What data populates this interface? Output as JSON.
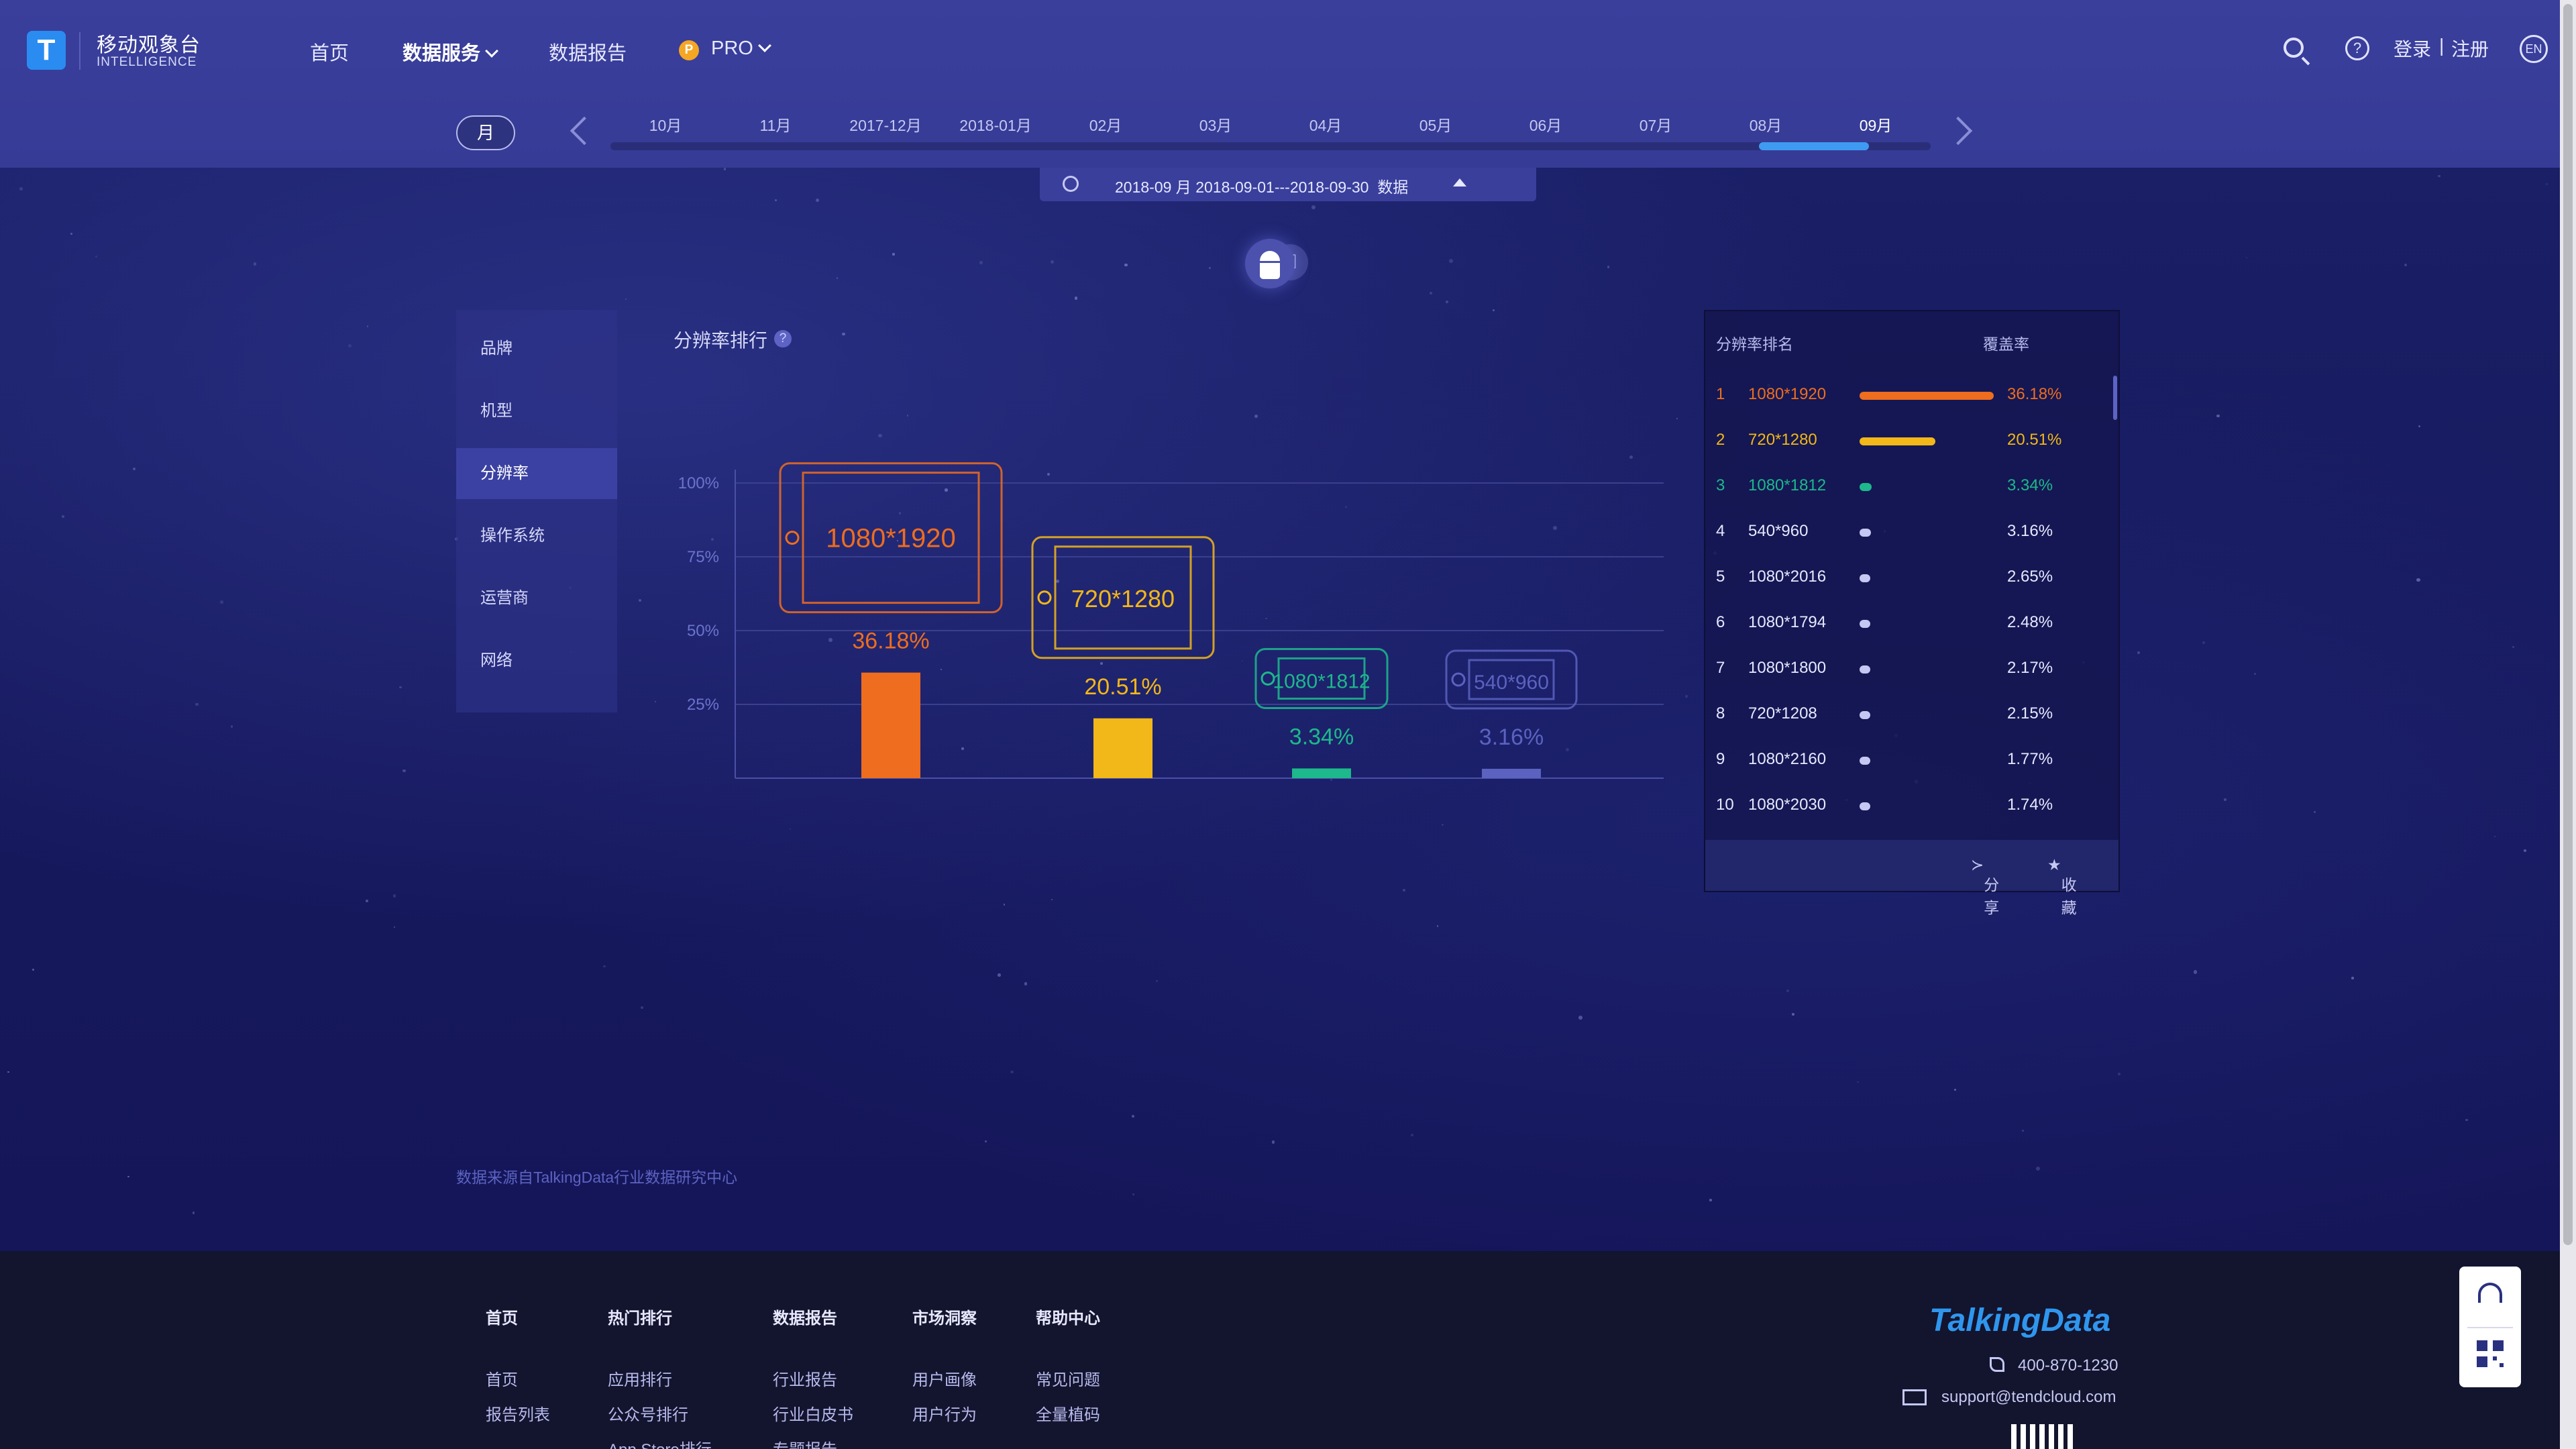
{
  "header": {
    "logo_letter": "T",
    "app_title": "移动观象台",
    "app_subtitle": "INTELLIGENCE",
    "nav": [
      {
        "label": "首页"
      },
      {
        "label": "数据服务"
      },
      {
        "label": "数据报告"
      },
      {
        "label": "PRO",
        "badge": "P"
      }
    ],
    "login": "登录",
    "divider": "|",
    "register": "注册",
    "lang": "EN",
    "help": "?"
  },
  "timeline": {
    "mode": "月",
    "months": [
      "10月",
      "11月",
      "2017-12月",
      "2018-01月",
      "02月",
      "03月",
      "04月",
      "05月",
      "06月",
      "07月",
      "08月",
      "09月"
    ],
    "selected": "09月",
    "date_range": "2018-09 月 2018-09-01---2018-09-30",
    "date_suffix": "数据"
  },
  "os_toggle": {
    "active": "android-icon",
    "inactive": "apple-icon"
  },
  "side_menu": {
    "items": [
      {
        "label": "品牌"
      },
      {
        "label": "机型"
      },
      {
        "label": "分辨率"
      },
      {
        "label": "操作系统"
      },
      {
        "label": "运营商"
      },
      {
        "label": "网络"
      }
    ],
    "active": "分辨率"
  },
  "chart_section": {
    "title": "分辨率排行",
    "help": "?"
  },
  "chart_data": {
    "type": "bar",
    "categories": [
      "1080*1920",
      "720*1280",
      "1080*1812",
      "540*960"
    ],
    "values": [
      36.18,
      20.51,
      3.34,
      3.16
    ],
    "value_labels": [
      "36.18%",
      "20.51%",
      "3.34%",
      "3.16%"
    ],
    "colors": [
      "#ee6d1e",
      "#f2b718",
      "#1db88c",
      "#5b62c0"
    ],
    "y_ticks": [
      "100%",
      "75%",
      "50%",
      "25%"
    ],
    "ylim": [
      0,
      100
    ],
    "grid": true
  },
  "ranking": {
    "col_rank": "分辨率排名",
    "col_rate": "覆盖率",
    "rows": [
      {
        "rank": "1",
        "resolution": "1080*1920",
        "rate": "36.18%",
        "value": 36.18,
        "color": "#ee6d1e"
      },
      {
        "rank": "2",
        "resolution": "720*1280",
        "rate": "20.51%",
        "value": 20.51,
        "color": "#f2b718"
      },
      {
        "rank": "3",
        "resolution": "1080*1812",
        "rate": "3.34%",
        "value": 3.34,
        "color": "#1db88c"
      },
      {
        "rank": "4",
        "resolution": "540*960",
        "rate": "3.16%",
        "value": 3.16,
        "color": "#c5c8f2"
      },
      {
        "rank": "5",
        "resolution": "1080*2016",
        "rate": "2.65%",
        "value": 2.65,
        "color": "#c5c8f2"
      },
      {
        "rank": "6",
        "resolution": "1080*1794",
        "rate": "2.48%",
        "value": 2.48,
        "color": "#c5c8f2"
      },
      {
        "rank": "7",
        "resolution": "1080*1800",
        "rate": "2.17%",
        "value": 2.17,
        "color": "#c5c8f2"
      },
      {
        "rank": "8",
        "resolution": "720*1208",
        "rate": "2.15%",
        "value": 2.15,
        "color": "#c5c8f2"
      },
      {
        "rank": "9",
        "resolution": "1080*2160",
        "rate": "1.77%",
        "value": 1.77,
        "color": "#c5c8f2"
      },
      {
        "rank": "10",
        "resolution": "1080*2030",
        "rate": "1.74%",
        "value": 1.74,
        "color": "#c5c8f2"
      }
    ],
    "share": "分享",
    "favorite": "收藏"
  },
  "source_note": "数据来源自TalkingData行业数据研究中心",
  "footer": {
    "columns": [
      {
        "title": "首页",
        "links": [
          "首页",
          "报告列表"
        ]
      },
      {
        "title": "热门排行",
        "links": [
          "应用排行",
          "公众号排行",
          "App Store排行"
        ]
      },
      {
        "title": "数据报告",
        "links": [
          "行业报告",
          "行业白皮书",
          "专题报告"
        ]
      },
      {
        "title": "市场洞察",
        "links": [
          "用户画像",
          "用户行为"
        ]
      },
      {
        "title": "帮助中心",
        "links": [
          "常见问题",
          "全量植码"
        ]
      }
    ],
    "brand": "TalkingData",
    "phone": "400-870-1230",
    "email": "support@tendcloud.com"
  }
}
